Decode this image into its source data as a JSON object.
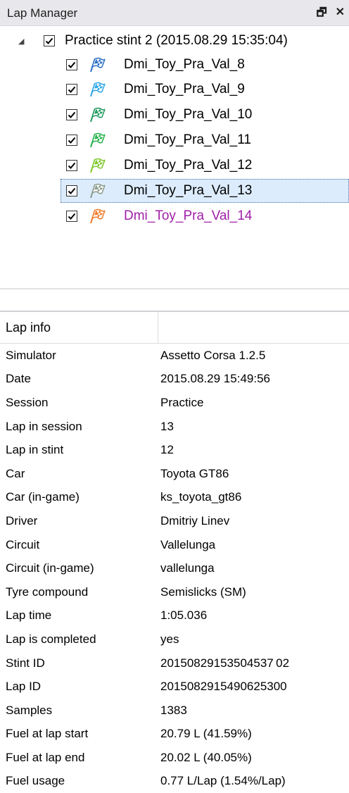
{
  "panel": {
    "title": "Lap Manager",
    "pin_glyph": "🗗",
    "close_glyph": "✕"
  },
  "tree": {
    "root": {
      "label": "Practice stint 2 (2015.08.29 15:35:04)",
      "checked": true,
      "expanded": true
    },
    "laps": [
      {
        "label": "Dmi_Toy_Pra_Val_8",
        "checked": true,
        "flag_color": "#2a6fc4",
        "text_color": "#000000",
        "selected": false
      },
      {
        "label": "Dmi_Toy_Pra_Val_9",
        "checked": true,
        "flag_color": "#2aa6e8",
        "text_color": "#000000",
        "selected": false
      },
      {
        "label": "Dmi_Toy_Pra_Val_10",
        "checked": true,
        "flag_color": "#1f9a5c",
        "text_color": "#000000",
        "selected": false
      },
      {
        "label": "Dmi_Toy_Pra_Val_11",
        "checked": true,
        "flag_color": "#22b04a",
        "text_color": "#000000",
        "selected": false
      },
      {
        "label": "Dmi_Toy_Pra_Val_12",
        "checked": true,
        "flag_color": "#7cc828",
        "text_color": "#000000",
        "selected": false
      },
      {
        "label": "Dmi_Toy_Pra_Val_13",
        "checked": true,
        "flag_color": "#8a9a8a",
        "text_color": "#000000",
        "selected": true
      },
      {
        "label": "Dmi_Toy_Pra_Val_14",
        "checked": true,
        "flag_color": "#f07a28",
        "text_color": "#a020a8",
        "selected": false
      }
    ]
  },
  "lap_info": {
    "header": "Lap info",
    "rows": [
      {
        "key": "Simulator",
        "value": "Assetto Corsa 1.2.5"
      },
      {
        "key": "Date",
        "value": "2015.08.29 15:49:56"
      },
      {
        "key": "Session",
        "value": "Practice"
      },
      {
        "key": "Lap in session",
        "value": "13"
      },
      {
        "key": "Lap in stint",
        "value": "12"
      },
      {
        "key": "Car",
        "value": "Toyota GT86"
      },
      {
        "key": "Car (in-game)",
        "value": "ks_toyota_gt86"
      },
      {
        "key": "Driver",
        "value": "Dmitriy Linev"
      },
      {
        "key": "Circuit",
        "value": "Vallelunga"
      },
      {
        "key": "Circuit (in-game)",
        "value": "vallelunga"
      },
      {
        "key": "Tyre compound",
        "value": "Semislicks (SM)"
      },
      {
        "key": "Lap time",
        "value": "1:05.036"
      },
      {
        "key": "Lap is completed",
        "value": "yes"
      },
      {
        "key": "Stint ID",
        "value": "20150829153504537 02"
      },
      {
        "key": "Lap ID",
        "value": "2015082915490625300"
      },
      {
        "key": "Samples",
        "value": "1383"
      },
      {
        "key": "Fuel at lap start",
        "value": "20.79 L (41.59%)"
      },
      {
        "key": "Fuel at lap end",
        "value": "20.02 L (40.05%)"
      },
      {
        "key": "Fuel usage",
        "value": "0.77 L/Lap (1.54%/Lap)"
      }
    ]
  }
}
